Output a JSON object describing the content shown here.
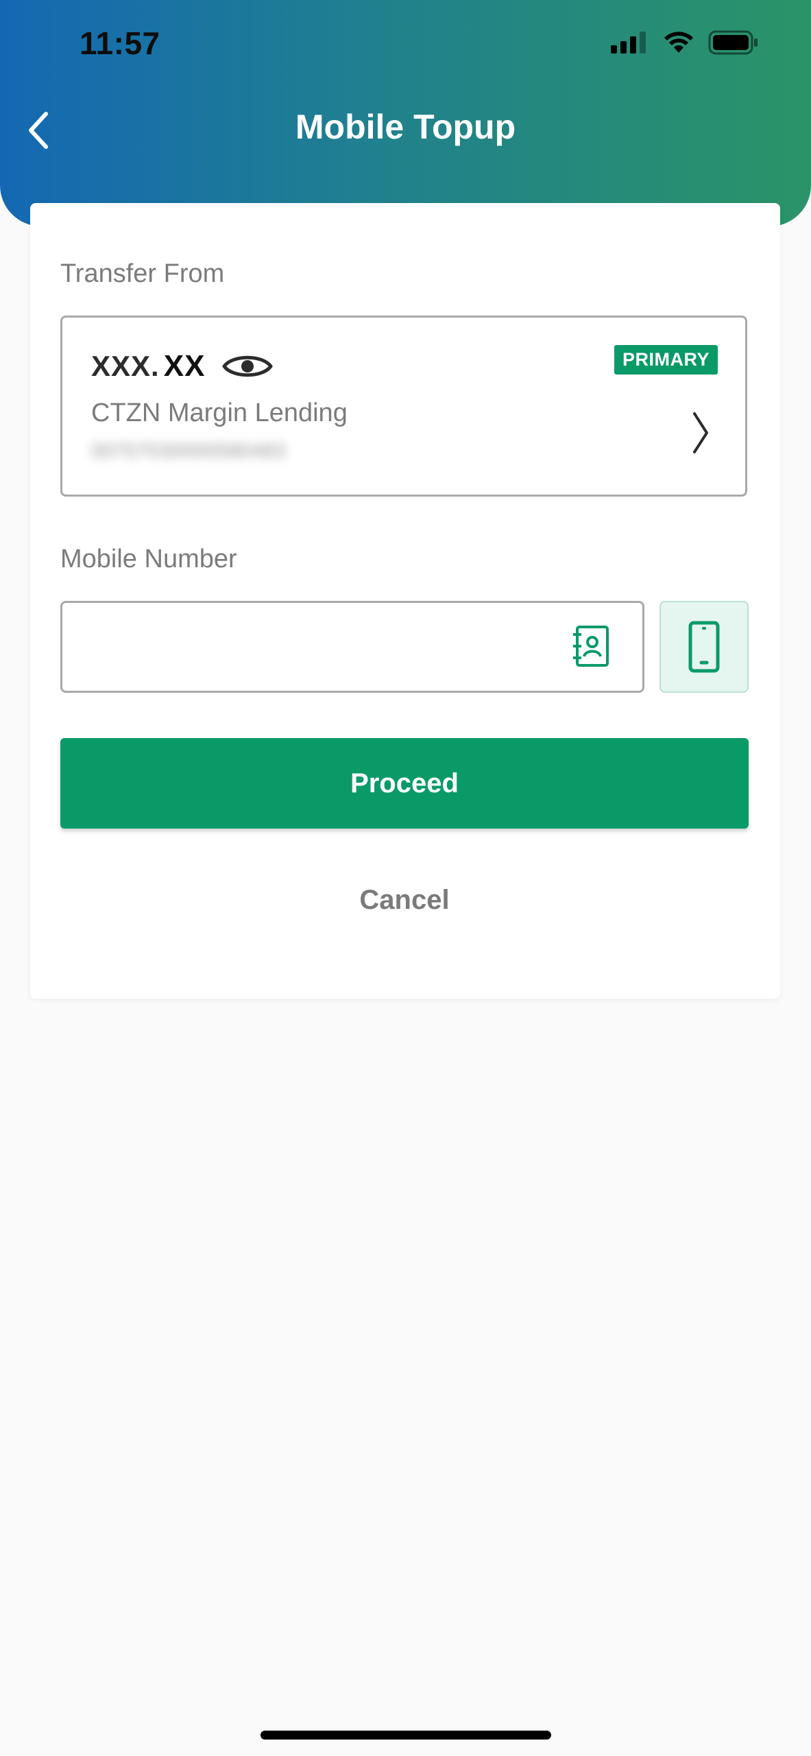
{
  "status_bar": {
    "time": "11:57",
    "icons": [
      "signal-icon",
      "wifi-icon",
      "battery-icon"
    ]
  },
  "header": {
    "title": "Mobile Topup",
    "back_icon": "chevron-left-icon"
  },
  "transfer_from": {
    "label": "Transfer From",
    "balance_masked": "XXX.",
    "balance_decimal": "XX",
    "badge": "PRIMARY",
    "account_name": "CTZN Margin Lending",
    "account_number": "00707030000580483"
  },
  "mobile_number": {
    "label": "Mobile Number",
    "value": "",
    "placeholder": ""
  },
  "actions": {
    "proceed_label": "Proceed",
    "cancel_label": "Cancel"
  },
  "colors": {
    "brand_green": "#0a9a68",
    "header_gradient_start": "#1468b3",
    "header_gradient_end": "#2a9467"
  }
}
